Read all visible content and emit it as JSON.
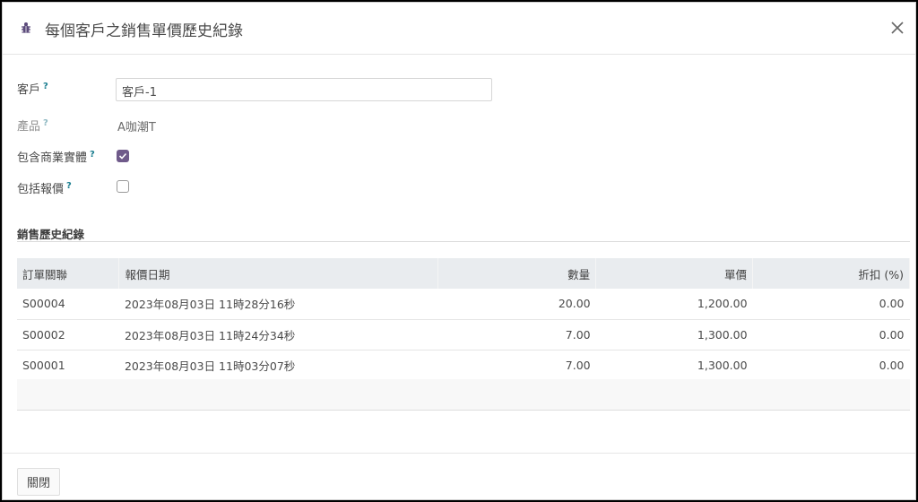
{
  "dialog": {
    "title": "每個客戶之銷售單價歷史紀錄",
    "close_icon": "close-icon",
    "title_icon": "bug-icon"
  },
  "form": {
    "customer": {
      "label": "客戶",
      "help": "?",
      "value": "客戶-1"
    },
    "product": {
      "label": "產品",
      "help": "?",
      "value": "A咖潮T"
    },
    "include_commercial_entity": {
      "label": "包含商業實體",
      "help": "?",
      "checked": true
    },
    "include_quotation": {
      "label": "包括報價",
      "help": "?",
      "checked": false
    }
  },
  "history": {
    "section_title": "銷售歷史紀錄",
    "columns": [
      "訂單關聯",
      "報價日期",
      "數量",
      "單價",
      "折扣 (%)"
    ],
    "rows": [
      [
        "S00004",
        "2023年08月03日 11時28分16秒",
        "20.00",
        "1,200.00",
        "0.00"
      ],
      [
        "S00002",
        "2023年08月03日 11時24分34秒",
        "7.00",
        "1,300.00",
        "0.00"
      ],
      [
        "S00001",
        "2023年08月03日 11時03分07秒",
        "7.00",
        "1,300.00",
        "0.00"
      ]
    ]
  },
  "footer": {
    "close_label": "關閉"
  },
  "colors": {
    "accent": "#6f5a8a",
    "help": "#1a7d8f",
    "table_header": "#e9ecef"
  }
}
